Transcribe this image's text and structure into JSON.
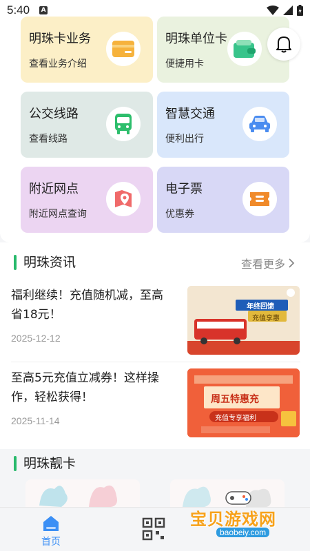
{
  "status_bar": {
    "time": "5:40",
    "notification_badge": "A"
  },
  "services": [
    {
      "title": "明珠卡业务",
      "subtitle": "查看业务介绍",
      "icon": "card-icon",
      "bg": "#fcefc7",
      "icon_bg": "#ffffff",
      "icon_color": "#f6b23c"
    },
    {
      "title": "明珠单位卡",
      "subtitle": "便捷用卡",
      "icon": "wallet-icon",
      "bg": "#eaf2df",
      "icon_bg": "#ffffff",
      "icon_color": "#38c48b"
    },
    {
      "title": "公交线路",
      "subtitle": "查看线路",
      "icon": "bus-icon",
      "bg": "#dfe9e6",
      "icon_bg": "#ffffff",
      "icon_color": "#2dbe6c"
    },
    {
      "title": "智慧交通",
      "subtitle": "便利出行",
      "icon": "car-icon",
      "bg": "#d9e7fb",
      "icon_bg": "#ffffff",
      "icon_color": "#4a8cf0"
    },
    {
      "title": "附近网点",
      "subtitle": "附近网点查询",
      "icon": "map-pin-icon",
      "bg": "#ecd5f2",
      "icon_bg": "#ffffff",
      "icon_color": "#f06a6a"
    },
    {
      "title": "电子票",
      "subtitle": "优惠券",
      "icon": "ticket-icon",
      "bg": "#d8d8f6",
      "icon_bg": "#ffffff",
      "icon_color": "#f08a2a"
    }
  ],
  "news_section": {
    "title": "明珠资讯",
    "more": "查看更多",
    "items": [
      {
        "title": "福利继续！充值随机减，至高省18元！",
        "date": "2025-12-12",
        "banner_badge": "年终回馈",
        "banner_sub": "充值享惠"
      },
      {
        "title": "至高5元充值立减券！这样操作，轻松获得！",
        "date": "2025-11-14",
        "banner_badge": "周五特惠充",
        "banner_sub": "充值专享福利"
      }
    ]
  },
  "cards_section": {
    "title": "明珠靓卡"
  },
  "tabbar": {
    "home": "首页"
  },
  "watermark": {
    "name": "宝贝游戏网",
    "url": "baobeiy.com"
  },
  "colors": {
    "accent": "#27b96b",
    "tab_active": "#3b8ff5"
  }
}
